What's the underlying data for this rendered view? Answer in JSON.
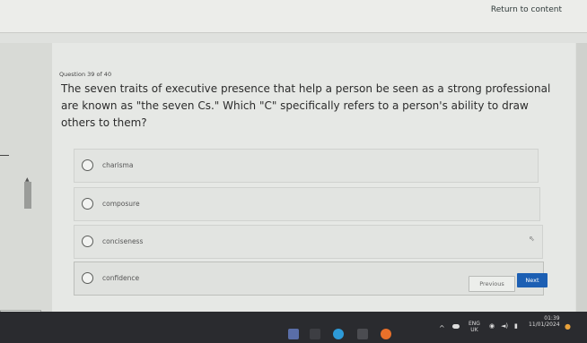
{
  "header": {
    "return_link": "Return to content"
  },
  "question": {
    "number": "Question 39 of 40",
    "text": "The seven traits of executive presence that help a person be seen as a strong professional are known as \"the seven Cs.\" Which \"C\" specifically refers to a person's ability to draw others to them?"
  },
  "options": [
    {
      "label": "charisma"
    },
    {
      "label": "composure"
    },
    {
      "label": "conciseness"
    },
    {
      "label": "confidence"
    }
  ],
  "buttons": {
    "previous": "Previous",
    "next": "Next"
  },
  "taskbar": {
    "lang": "ENG",
    "region": "UK",
    "time": "01:39",
    "date": "11/01/2024"
  },
  "colors": {
    "next_button": "#1c5fb3",
    "taskbar": "#2a2b2f"
  }
}
